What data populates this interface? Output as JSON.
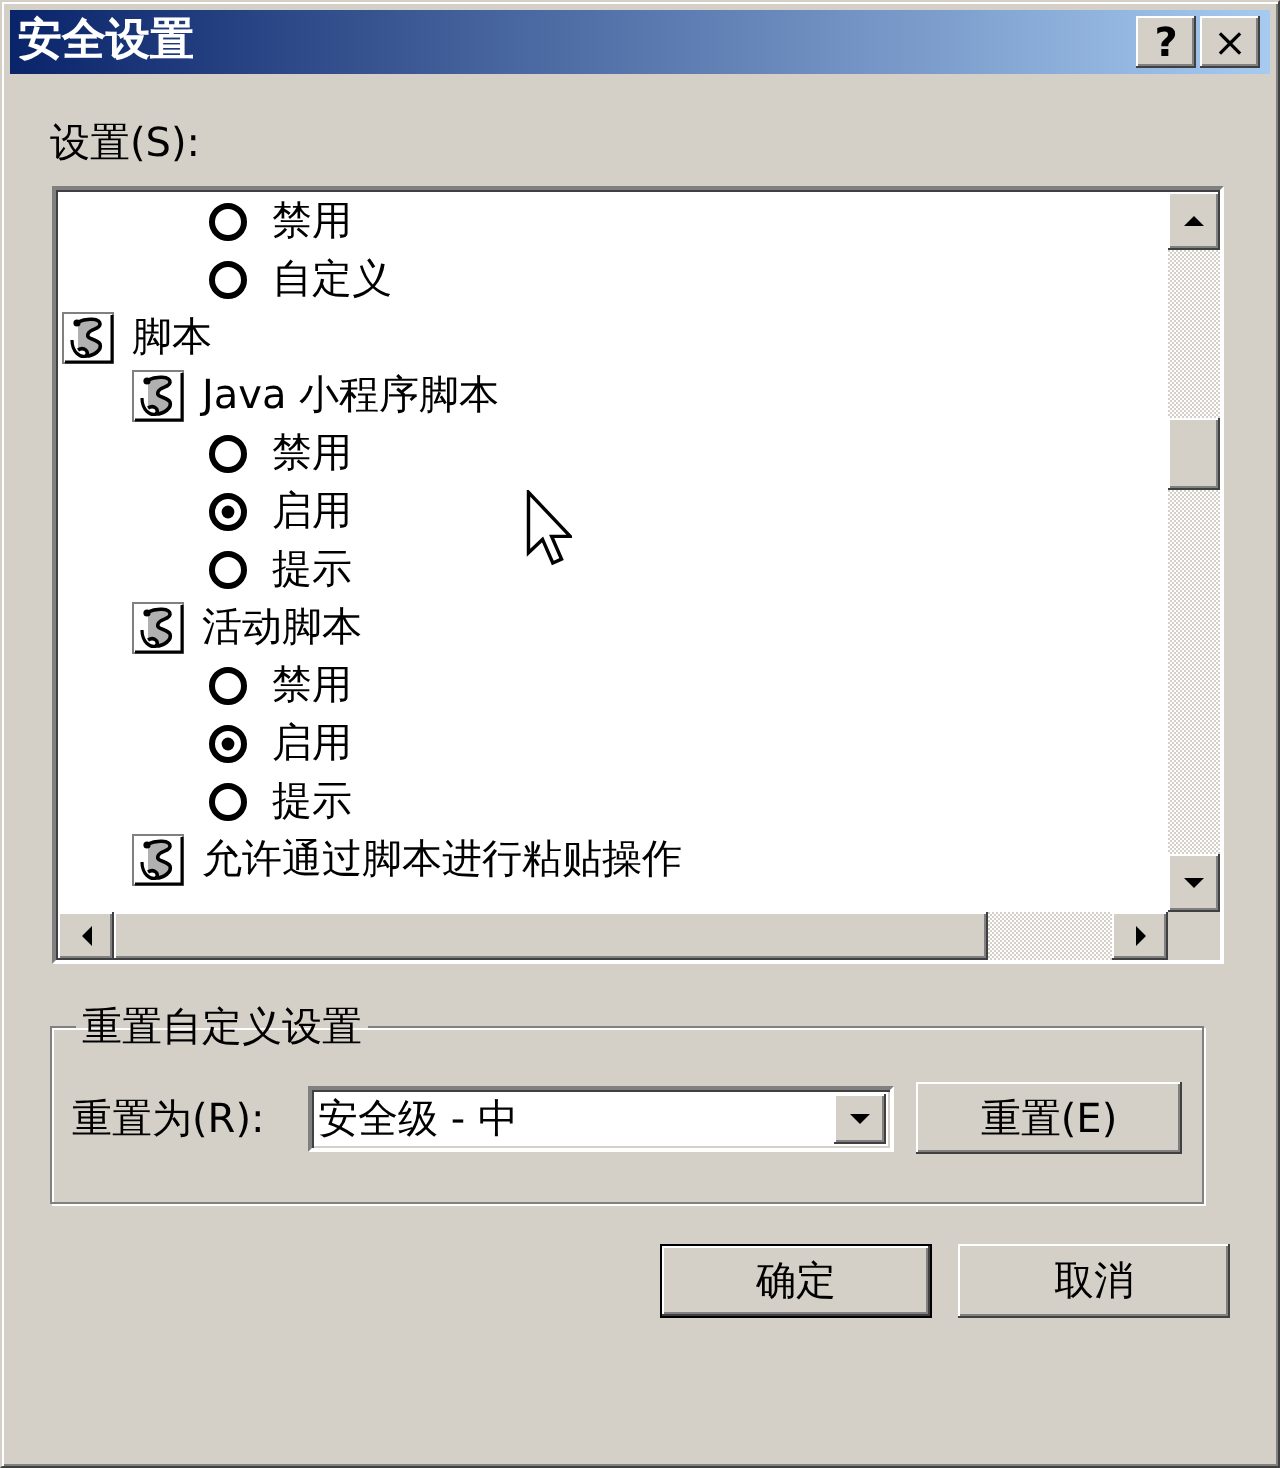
{
  "window": {
    "title": "安全设置",
    "help_button": "?",
    "close_button": "×"
  },
  "settings": {
    "label": "设置(S):",
    "tree": [
      {
        "children": [
          {
            "children": [
              {
                "kind": "option",
                "label": "禁用",
                "selected": false
              },
              {
                "kind": "option",
                "label": "自定义",
                "selected": false
              }
            ]
          }
        ]
      },
      {
        "kind": "group",
        "label": "脚本",
        "children": [
          {
            "kind": "group",
            "label": "Java 小程序脚本",
            "children": [
              {
                "kind": "option",
                "label": "禁用",
                "selected": false
              },
              {
                "kind": "option",
                "label": "启用",
                "selected": true
              },
              {
                "kind": "option",
                "label": "提示",
                "selected": false
              }
            ]
          },
          {
            "kind": "group",
            "label": "活动脚本",
            "children": [
              {
                "kind": "option",
                "label": "禁用",
                "selected": false
              },
              {
                "kind": "option",
                "label": "启用",
                "selected": true
              },
              {
                "kind": "option",
                "label": "提示",
                "selected": false
              }
            ]
          },
          {
            "kind": "group",
            "label": "允许通过脚本进行粘贴操作"
          }
        ]
      }
    ]
  },
  "reset": {
    "title": "重置自定义设置",
    "label": "重置为(R):",
    "value": "安全级 - 中",
    "button": "重置(E)"
  },
  "buttons": [
    {
      "label": "确定",
      "default": true
    },
    {
      "label": "取消",
      "default": false
    }
  ]
}
